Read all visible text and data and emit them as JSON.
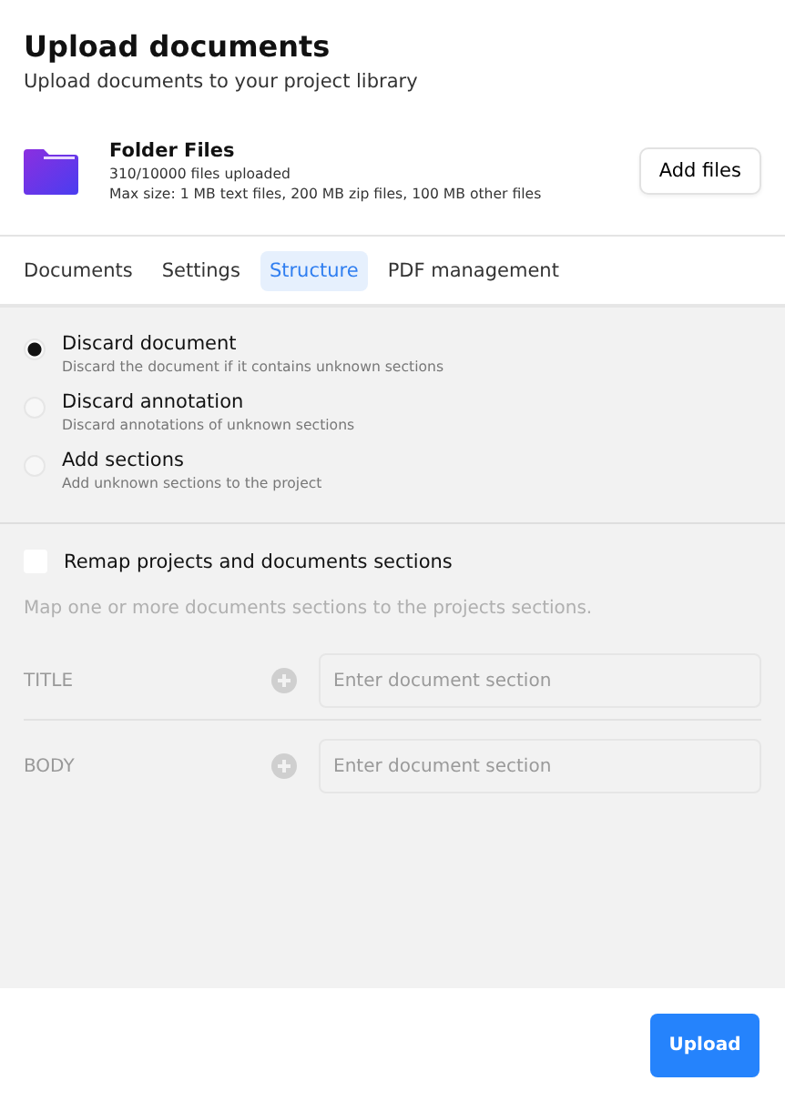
{
  "header": {
    "title": "Upload documents",
    "subtitle": "Upload documents to your project library"
  },
  "folder": {
    "name": "Folder Files",
    "count": "310/10000 files uploaded",
    "limits": "Max size: 1 MB text files, 200 MB zip files, 100 MB other files",
    "button": "Add files"
  },
  "tabs": [
    {
      "label": "Documents",
      "selected": false
    },
    {
      "label": "Settings",
      "selected": false
    },
    {
      "label": "Structure",
      "selected": true
    },
    {
      "label": "PDF management",
      "selected": false
    }
  ],
  "options": [
    {
      "label": "Discard document",
      "description": "Discard the document if it contains unknown sections",
      "selected": true
    },
    {
      "label": "Discard annotation",
      "description": "Discard annotations of unknown sections",
      "selected": false
    },
    {
      "label": "Add sections",
      "description": "Add unknown sections to the project",
      "selected": false
    }
  ],
  "remap": {
    "label": "Remap projects and documents sections",
    "checked": false,
    "hint": "Map one or more documents sections to the projects sections."
  },
  "mappings": [
    {
      "section": "TITLE",
      "placeholder": "Enter document section"
    },
    {
      "section": "BODY",
      "placeholder": "Enter document section"
    }
  ],
  "footer": {
    "button": "Upload"
  }
}
